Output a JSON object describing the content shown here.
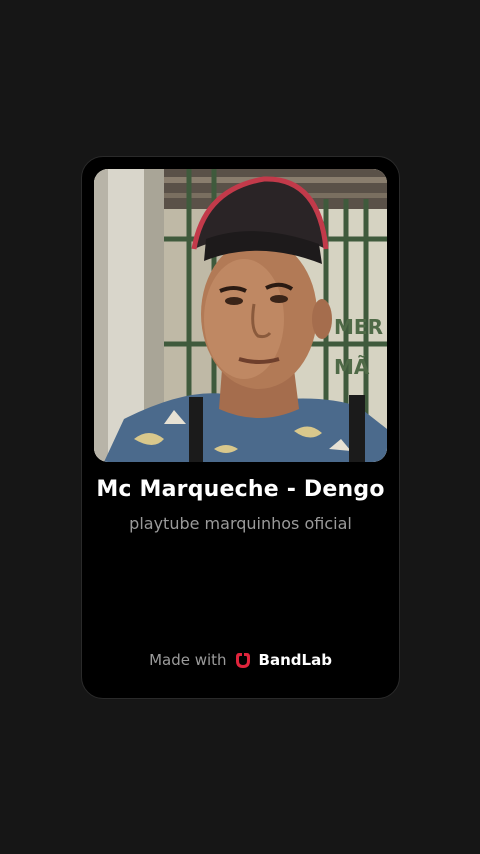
{
  "track": {
    "title": "Mc Marqueche - Dengo",
    "artist": "playtube marquinhos oficial"
  },
  "footer": {
    "made_with": "Made with",
    "brand": "BandLab",
    "brand_color": "#e0243c"
  },
  "cover": {
    "wall_text_1": "MER",
    "wall_text_2": "MÃ"
  }
}
